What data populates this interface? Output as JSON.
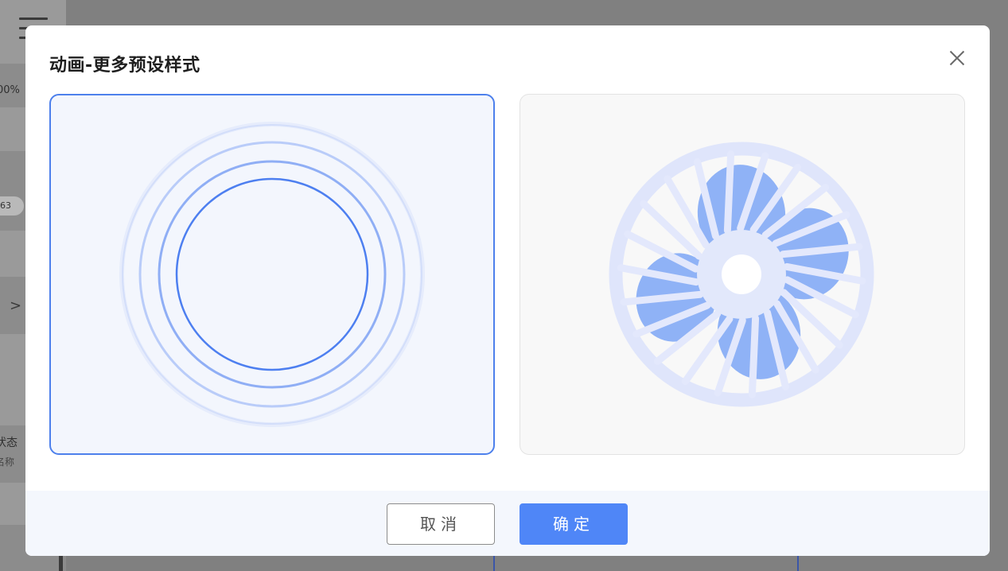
{
  "background": {
    "percent_label": "00%",
    "pill_label": "63",
    "state_label": "状态",
    "name_label": "名称"
  },
  "dialog": {
    "title": "动画-更多预设样式",
    "options": [
      {
        "id": "ripple",
        "selected": true
      },
      {
        "id": "fan",
        "selected": false
      }
    ],
    "cancel_label": "取消",
    "ok_label": "确定"
  },
  "colors": {
    "accent": "#4f86f7",
    "selected_border": "#4d80ec",
    "selected_bg": "#f3f6fd"
  }
}
